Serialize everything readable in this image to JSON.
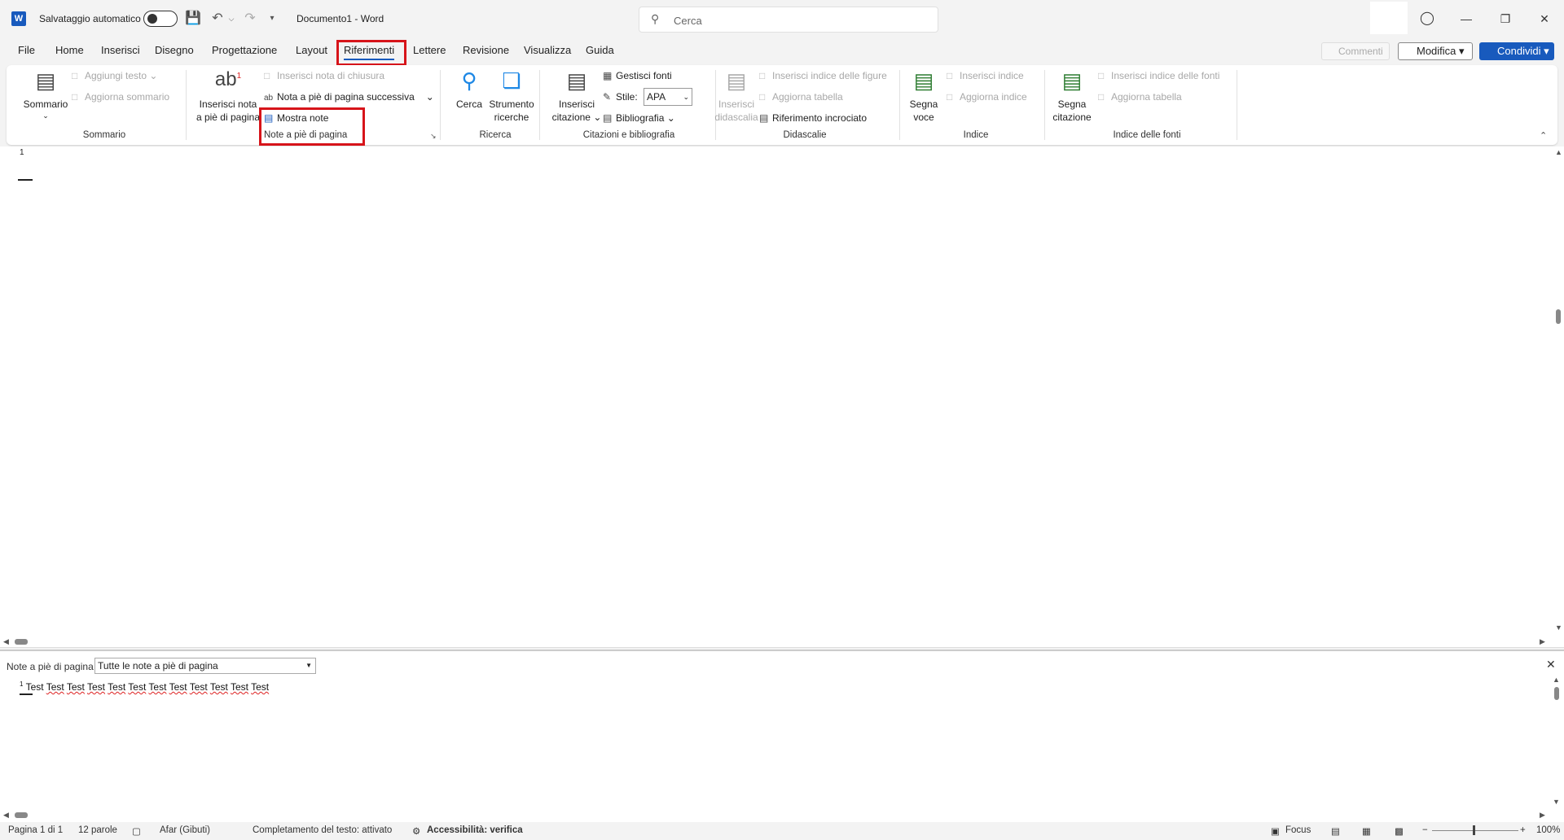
{
  "titlebar": {
    "autosave_label": "Salvataggio automatico",
    "doc_title": "Documento1 - Word",
    "search_placeholder": "Cerca"
  },
  "tabs": [
    "File",
    "Home",
    "Inserisci",
    "Disegno",
    "Progettazione",
    "Layout",
    "Riferimenti",
    "Lettere",
    "Revisione",
    "Visualizza",
    "Guida"
  ],
  "active_tab": "Riferimenti",
  "top_right": {
    "commenti": "Commenti",
    "modifica": "Modifica",
    "condividi": "Condividi"
  },
  "ribbon": {
    "sommario": {
      "big": "Sommario",
      "aggiungi_testo": "Aggiungi testo",
      "aggiorna_sommario": "Aggiorna sommario",
      "label": "Sommario"
    },
    "note": {
      "big_line1": "Inserisci nota",
      "big_line2": "a piè di pagina",
      "inserisci_nota_chiusura": "Inserisci nota di chiusura",
      "nota_successiva": "Nota a piè di pagina successiva",
      "mostra_note": "Mostra note",
      "label": "Note a piè di pagina"
    },
    "ricerca": {
      "cerca": "Cerca",
      "strumento_line1": "Strumento",
      "strumento_line2": "ricerche",
      "label": "Ricerca"
    },
    "citazioni": {
      "inserisci_line1": "Inserisci",
      "inserisci_line2": "citazione",
      "gestisci_fonti": "Gestisci fonti",
      "stile_label": "Stile:",
      "stile_value": "APA",
      "bibliografia": "Bibliografia",
      "label": "Citazioni e bibliografia"
    },
    "didascalie": {
      "inserisci_line1": "Inserisci",
      "inserisci_line2": "didascalia",
      "indice_figure": "Inserisci indice delle figure",
      "aggiorna_tabella": "Aggiorna tabella",
      "riferimento": "Riferimento incrociato",
      "label": "Didascalie"
    },
    "indice": {
      "segna_line1": "Segna",
      "segna_line2": "voce",
      "inserisci_indice": "Inserisci indice",
      "aggiorna_indice": "Aggiorna indice",
      "label": "Indice"
    },
    "indice_fonti": {
      "segna_line1": "Segna",
      "segna_line2": "citazione",
      "inserisci": "Inserisci indice delle fonti",
      "aggiorna": "Aggiorna tabella",
      "label": "Indice delle fonti"
    }
  },
  "document": {
    "page_marker": "1"
  },
  "footnote_pane": {
    "label": "Note a piè di pagina",
    "select_value": "Tutte le note a piè di pagina",
    "note_number": "1",
    "words": [
      "Test",
      "Test",
      "Test",
      "Test",
      "Test",
      "Test",
      "Test",
      "Test",
      "Test",
      "Test",
      "Test",
      "Test"
    ]
  },
  "statusbar": {
    "page": "Pagina 1 di 1",
    "words": "12 parole",
    "language": "Afar (Gibuti)",
    "completion": "Completamento del testo: attivato",
    "accessibility": "Accessibilità: verifica",
    "focus": "Focus",
    "zoom": "100%"
  }
}
